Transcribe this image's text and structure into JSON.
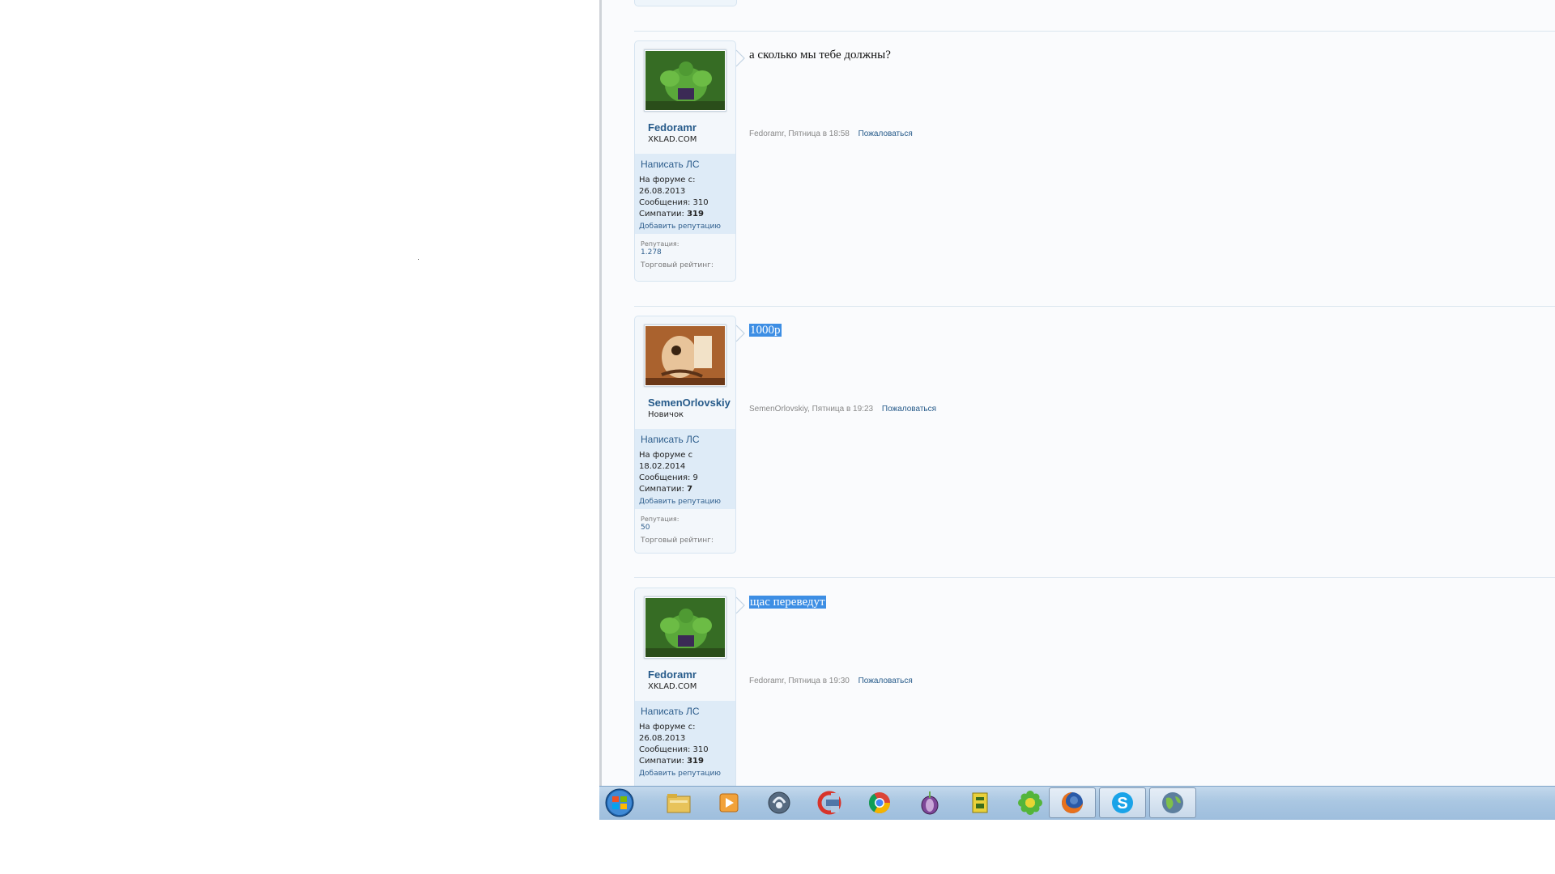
{
  "posts": [
    {
      "username": "Fedoramr",
      "user_title": "XKLAD.COM",
      "pm_label": "Написать ЛС",
      "joined": "На форуме с:",
      "joined_date": "26.08.2013",
      "messages": "Сообщения: 310",
      "likes_label": "Симпатии:",
      "likes_value": "319",
      "add_rep": "Добавить репутацию",
      "rep_label": "Репутация:",
      "rep_value": "1.278",
      "trade_label": "Торговый рейтинг:",
      "text": "а сколько мы тебе должны?",
      "meta": "Fedoramr, Пятница в 18:58",
      "report": "Пожаловаться"
    },
    {
      "username": "SemenOrlovskiy",
      "user_title": "Новичок",
      "pm_label": "Написать ЛС",
      "joined": "На форуме с",
      "joined_date": "18.02.2014",
      "messages": "Сообщения: 9",
      "likes_label": "Симпатии:",
      "likes_value": "7",
      "add_rep": "Добавить репутацию",
      "rep_label": "Репутация:",
      "rep_value": "50",
      "trade_label": "Торговый рейтинг:",
      "text": "1000р",
      "meta": "SemenOrlovskiy, Пятница в 19:23",
      "report": "Пожаловаться"
    },
    {
      "username": "Fedoramr",
      "user_title": "XKLAD.COM",
      "pm_label": "Написать ЛС",
      "joined": "На форуме с:",
      "joined_date": "26.08.2013",
      "messages": "Сообщения: 310",
      "likes_label": "Симпатии:",
      "likes_value": "319",
      "add_rep": "Добавить репутацию",
      "text": "щас переведут",
      "meta": "Fedoramr, Пятница в 19:30",
      "report": "Пожаловаться"
    }
  ],
  "taskbar": {
    "items": [
      "start-orb",
      "explorer-icon",
      "media-player-icon",
      "teamspeak-icon",
      "ccleaner-icon",
      "chrome-icon",
      "tor-icon",
      "game-launcher-icon",
      "icq-icon",
      "firefox-icon",
      "skype-icon",
      "network-globe-icon"
    ],
    "active": [
      "firefox-icon",
      "skype-icon",
      "network-globe-icon"
    ]
  },
  "colors": {
    "link": "#2d5d8c",
    "username": "#275b8a",
    "selection": "#3d8ee4",
    "userbox_bg": "#f3f7fb",
    "extra_bg": "#deebf7"
  }
}
